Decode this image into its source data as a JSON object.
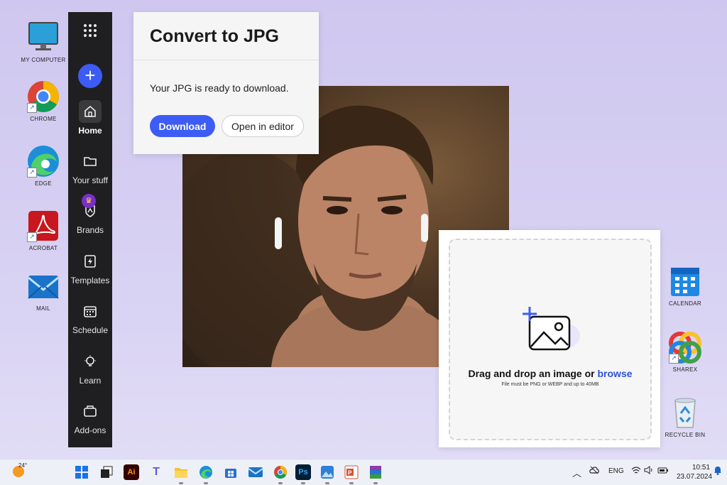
{
  "desktop": {
    "left_icons": [
      {
        "label": "MY COMPUTER",
        "icon": "monitor-icon"
      },
      {
        "label": "CHROME",
        "icon": "chrome-icon"
      },
      {
        "label": "EDGE",
        "icon": "edge-icon"
      },
      {
        "label": "ACROBAT",
        "icon": "acrobat-icon"
      },
      {
        "label": "MAIL",
        "icon": "mail-icon"
      }
    ],
    "right_icons": [
      {
        "label": "CALENDAR",
        "icon": "calendar-icon"
      },
      {
        "label": "SHAREX",
        "icon": "sharex-icon"
      },
      {
        "label": "RECYCLE BIN",
        "icon": "recycle-bin-icon"
      }
    ]
  },
  "sidebar": {
    "plus": "+",
    "items": [
      {
        "label": "Home",
        "icon": "home-icon",
        "active": true
      },
      {
        "label": "Your stuff",
        "icon": "folder-icon"
      },
      {
        "label": "Brands",
        "icon": "brand-icon"
      },
      {
        "label": "Templates",
        "icon": "template-icon"
      },
      {
        "label": "Schedule",
        "icon": "calendar-icon"
      },
      {
        "label": "Learn",
        "icon": "lightbulb-icon"
      },
      {
        "label": "Add-ons",
        "icon": "addons-icon"
      }
    ],
    "crown": "♛"
  },
  "convert": {
    "title": "Convert to JPG",
    "message": "Your JPG is ready to download.",
    "download_label": "Download",
    "editor_label": "Open in editor"
  },
  "upload": {
    "title_prefix": "Drag and drop an image or ",
    "browse": "browse",
    "subtitle": "File must be PNG or WEBP and up to 40MB"
  },
  "taskbar": {
    "weather": "24°",
    "language": "ENG",
    "time": "10:51",
    "date": "23.07.2024",
    "apps": [
      "start-icon",
      "taskview-icon",
      "illustrator-icon",
      "teams-icon",
      "explorer-icon",
      "edge-icon",
      "store-icon",
      "mail-icon",
      "chrome-icon",
      "photoshop-icon",
      "photos-icon",
      "powerpoint-icon",
      "winrar-icon"
    ]
  },
  "colors": {
    "accent": "#3d5cf5",
    "sidebar": "#1f1f21"
  }
}
